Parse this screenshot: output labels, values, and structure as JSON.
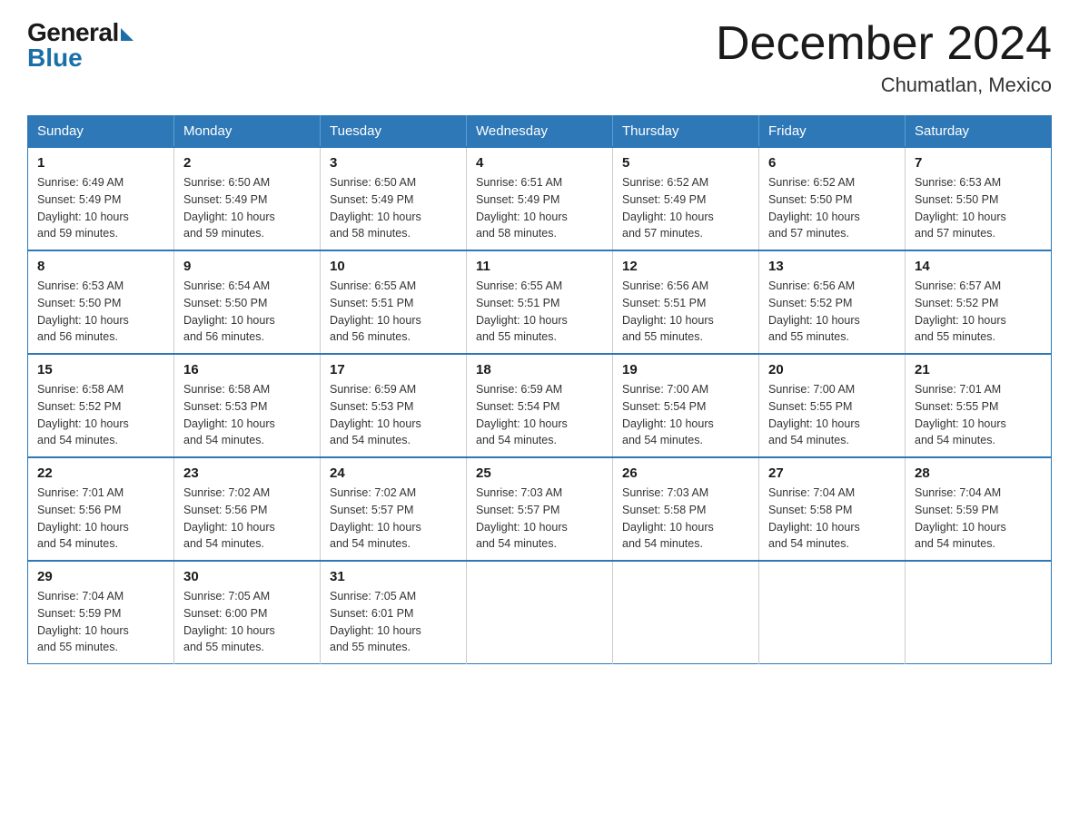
{
  "logo": {
    "general": "General",
    "blue": "Blue"
  },
  "title": "December 2024",
  "location": "Chumatlan, Mexico",
  "days_of_week": [
    "Sunday",
    "Monday",
    "Tuesday",
    "Wednesday",
    "Thursday",
    "Friday",
    "Saturday"
  ],
  "weeks": [
    [
      {
        "day": "1",
        "sunrise": "6:49 AM",
        "sunset": "5:49 PM",
        "daylight": "10 hours and 59 minutes."
      },
      {
        "day": "2",
        "sunrise": "6:50 AM",
        "sunset": "5:49 PM",
        "daylight": "10 hours and 59 minutes."
      },
      {
        "day": "3",
        "sunrise": "6:50 AM",
        "sunset": "5:49 PM",
        "daylight": "10 hours and 58 minutes."
      },
      {
        "day": "4",
        "sunrise": "6:51 AM",
        "sunset": "5:49 PM",
        "daylight": "10 hours and 58 minutes."
      },
      {
        "day": "5",
        "sunrise": "6:52 AM",
        "sunset": "5:49 PM",
        "daylight": "10 hours and 57 minutes."
      },
      {
        "day": "6",
        "sunrise": "6:52 AM",
        "sunset": "5:50 PM",
        "daylight": "10 hours and 57 minutes."
      },
      {
        "day": "7",
        "sunrise": "6:53 AM",
        "sunset": "5:50 PM",
        "daylight": "10 hours and 57 minutes."
      }
    ],
    [
      {
        "day": "8",
        "sunrise": "6:53 AM",
        "sunset": "5:50 PM",
        "daylight": "10 hours and 56 minutes."
      },
      {
        "day": "9",
        "sunrise": "6:54 AM",
        "sunset": "5:50 PM",
        "daylight": "10 hours and 56 minutes."
      },
      {
        "day": "10",
        "sunrise": "6:55 AM",
        "sunset": "5:51 PM",
        "daylight": "10 hours and 56 minutes."
      },
      {
        "day": "11",
        "sunrise": "6:55 AM",
        "sunset": "5:51 PM",
        "daylight": "10 hours and 55 minutes."
      },
      {
        "day": "12",
        "sunrise": "6:56 AM",
        "sunset": "5:51 PM",
        "daylight": "10 hours and 55 minutes."
      },
      {
        "day": "13",
        "sunrise": "6:56 AM",
        "sunset": "5:52 PM",
        "daylight": "10 hours and 55 minutes."
      },
      {
        "day": "14",
        "sunrise": "6:57 AM",
        "sunset": "5:52 PM",
        "daylight": "10 hours and 55 minutes."
      }
    ],
    [
      {
        "day": "15",
        "sunrise": "6:58 AM",
        "sunset": "5:52 PM",
        "daylight": "10 hours and 54 minutes."
      },
      {
        "day": "16",
        "sunrise": "6:58 AM",
        "sunset": "5:53 PM",
        "daylight": "10 hours and 54 minutes."
      },
      {
        "day": "17",
        "sunrise": "6:59 AM",
        "sunset": "5:53 PM",
        "daylight": "10 hours and 54 minutes."
      },
      {
        "day": "18",
        "sunrise": "6:59 AM",
        "sunset": "5:54 PM",
        "daylight": "10 hours and 54 minutes."
      },
      {
        "day": "19",
        "sunrise": "7:00 AM",
        "sunset": "5:54 PM",
        "daylight": "10 hours and 54 minutes."
      },
      {
        "day": "20",
        "sunrise": "7:00 AM",
        "sunset": "5:55 PM",
        "daylight": "10 hours and 54 minutes."
      },
      {
        "day": "21",
        "sunrise": "7:01 AM",
        "sunset": "5:55 PM",
        "daylight": "10 hours and 54 minutes."
      }
    ],
    [
      {
        "day": "22",
        "sunrise": "7:01 AM",
        "sunset": "5:56 PM",
        "daylight": "10 hours and 54 minutes."
      },
      {
        "day": "23",
        "sunrise": "7:02 AM",
        "sunset": "5:56 PM",
        "daylight": "10 hours and 54 minutes."
      },
      {
        "day": "24",
        "sunrise": "7:02 AM",
        "sunset": "5:57 PM",
        "daylight": "10 hours and 54 minutes."
      },
      {
        "day": "25",
        "sunrise": "7:03 AM",
        "sunset": "5:57 PM",
        "daylight": "10 hours and 54 minutes."
      },
      {
        "day": "26",
        "sunrise": "7:03 AM",
        "sunset": "5:58 PM",
        "daylight": "10 hours and 54 minutes."
      },
      {
        "day": "27",
        "sunrise": "7:04 AM",
        "sunset": "5:58 PM",
        "daylight": "10 hours and 54 minutes."
      },
      {
        "day": "28",
        "sunrise": "7:04 AM",
        "sunset": "5:59 PM",
        "daylight": "10 hours and 54 minutes."
      }
    ],
    [
      {
        "day": "29",
        "sunrise": "7:04 AM",
        "sunset": "5:59 PM",
        "daylight": "10 hours and 55 minutes."
      },
      {
        "day": "30",
        "sunrise": "7:05 AM",
        "sunset": "6:00 PM",
        "daylight": "10 hours and 55 minutes."
      },
      {
        "day": "31",
        "sunrise": "7:05 AM",
        "sunset": "6:01 PM",
        "daylight": "10 hours and 55 minutes."
      },
      null,
      null,
      null,
      null
    ]
  ],
  "labels": {
    "sunrise": "Sunrise:",
    "sunset": "Sunset:",
    "daylight": "Daylight:"
  }
}
